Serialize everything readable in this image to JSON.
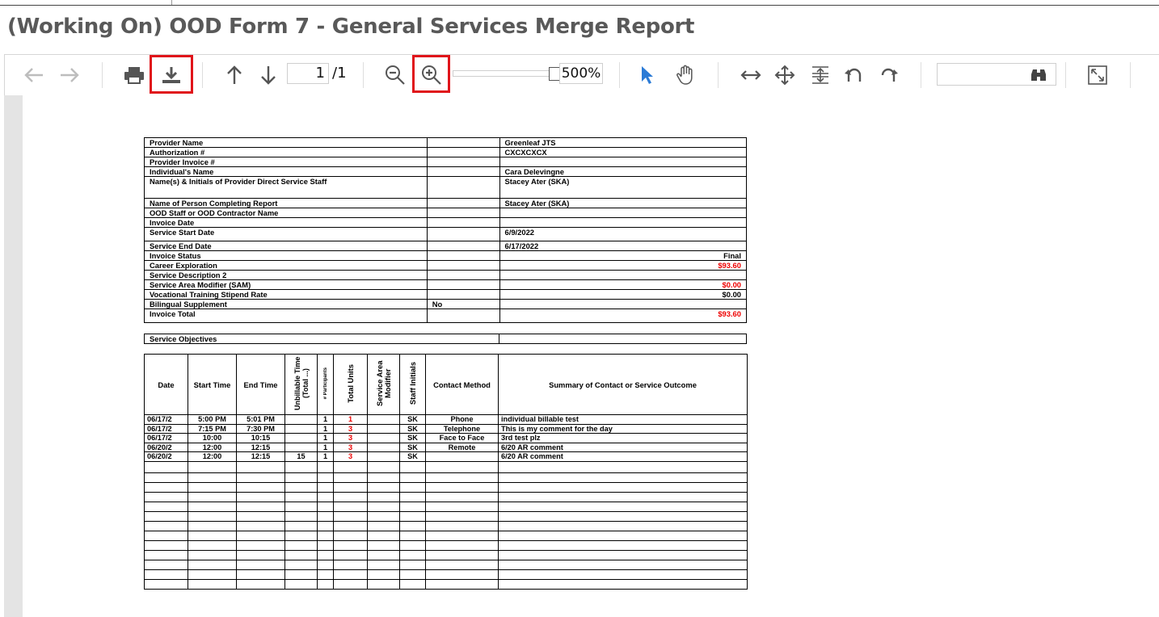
{
  "page": {
    "title": "(Working On) OOD Form 7 - General Services Merge Report"
  },
  "toolbar": {
    "page_current": "1",
    "page_total": "/1",
    "zoom": "500%",
    "highlight_color": "#e0141a",
    "icons": [
      "arrow-left-icon",
      "arrow-right-icon",
      "print-icon",
      "download-icon",
      "arrow-up-icon",
      "arrow-down-icon",
      "zoom-out-icon",
      "zoom-in-icon",
      "select-cursor-icon",
      "hand-pan-icon",
      "fit-width-icon",
      "move-icon",
      "fit-page-icon",
      "rotate-left-icon",
      "rotate-right-icon",
      "binoculars-icon",
      "fullscreen-icon"
    ]
  },
  "report": {
    "info_rows": [
      {
        "label": "Provider Name",
        "value": ""
      },
      {
        "label": "Authorization #",
        "value": ""
      },
      {
        "label": "Provider Invoice #",
        "value": ""
      },
      {
        "label": "Individual's Name",
        "value": ""
      },
      {
        "label": "Name(s) & Initials of Provider Direct Service Staff",
        "value": ""
      },
      {
        "label": "Name of Person Completing Report",
        "value": ""
      },
      {
        "label": "OOD Staff or OOD Contractor Name",
        "value": ""
      },
      {
        "label": "Invoice Date",
        "value": ""
      },
      {
        "label": "Service Start Date",
        "value": ""
      },
      {
        "label": "Service End Date",
        "value": ""
      },
      {
        "label": "Invoice Status",
        "value": ""
      },
      {
        "label": "Career Exploration",
        "value": ""
      },
      {
        "label": "Service Description 2",
        "value": ""
      },
      {
        "label": "Service Area Modifier (SAM)",
        "value": ""
      },
      {
        "label": "Vocational Training Stipend Rate",
        "value": ""
      },
      {
        "label": "Bilingual Supplement",
        "value": "No"
      },
      {
        "label": "Invoice Total",
        "value": ""
      }
    ],
    "right_values": [
      "Greenleaf JTS",
      "CXCXCXCX",
      "",
      "Cara Delevingne",
      "Stacey Ater (SKA)",
      "Stacey Ater (SKA)",
      "",
      "",
      "6/9/2022",
      "6/17/2022",
      "Final",
      "$93.60",
      "",
      "$0.00",
      "$0.00",
      "",
      "$93.60"
    ],
    "objectives_label": "Service Objectives",
    "activity_headers": {
      "date": "Date",
      "start": "Start Time",
      "end": "End Time",
      "unbillable": "Unbillable Time (Total ...)",
      "participants": "# Participants",
      "units": "Total Units",
      "area": "Service Area Modifier",
      "staff": "Staff Initials",
      "contact": "Contact Method",
      "summary": "Summary of Contact or Service Outcome"
    },
    "activity_rows": [
      {
        "date": "06/17/2",
        "start": "5:00 PM",
        "end": "5:01 PM",
        "unbill": "",
        "part": "1",
        "units": "1",
        "area": "",
        "staff": "SK",
        "contact": "Phone",
        "summary": "individual billable test"
      },
      {
        "date": "06/17/2",
        "start": "7:15 PM",
        "end": "7:30 PM",
        "unbill": "",
        "part": "1",
        "units": "3",
        "area": "",
        "staff": "SK",
        "contact": "Telephone",
        "summary": "This is my comment for the day"
      },
      {
        "date": "06/17/2",
        "start": "10:00",
        "end": "10:15",
        "unbill": "",
        "part": "1",
        "units": "3",
        "area": "",
        "staff": "SK",
        "contact": "Face to Face",
        "summary": "3rd test plz"
      },
      {
        "date": "06/20/2",
        "start": "12:00",
        "end": "12:15",
        "unbill": "",
        "part": "1",
        "units": "3",
        "area": "",
        "staff": "SK",
        "contact": "Remote",
        "summary": "6/20 AR comment"
      },
      {
        "date": "06/20/2",
        "start": "12:00",
        "end": "12:15",
        "unbill": "15",
        "part": "1",
        "units": "3",
        "area": "",
        "staff": "SK",
        "contact": "",
        "summary": "6/20 AR comment"
      }
    ]
  }
}
